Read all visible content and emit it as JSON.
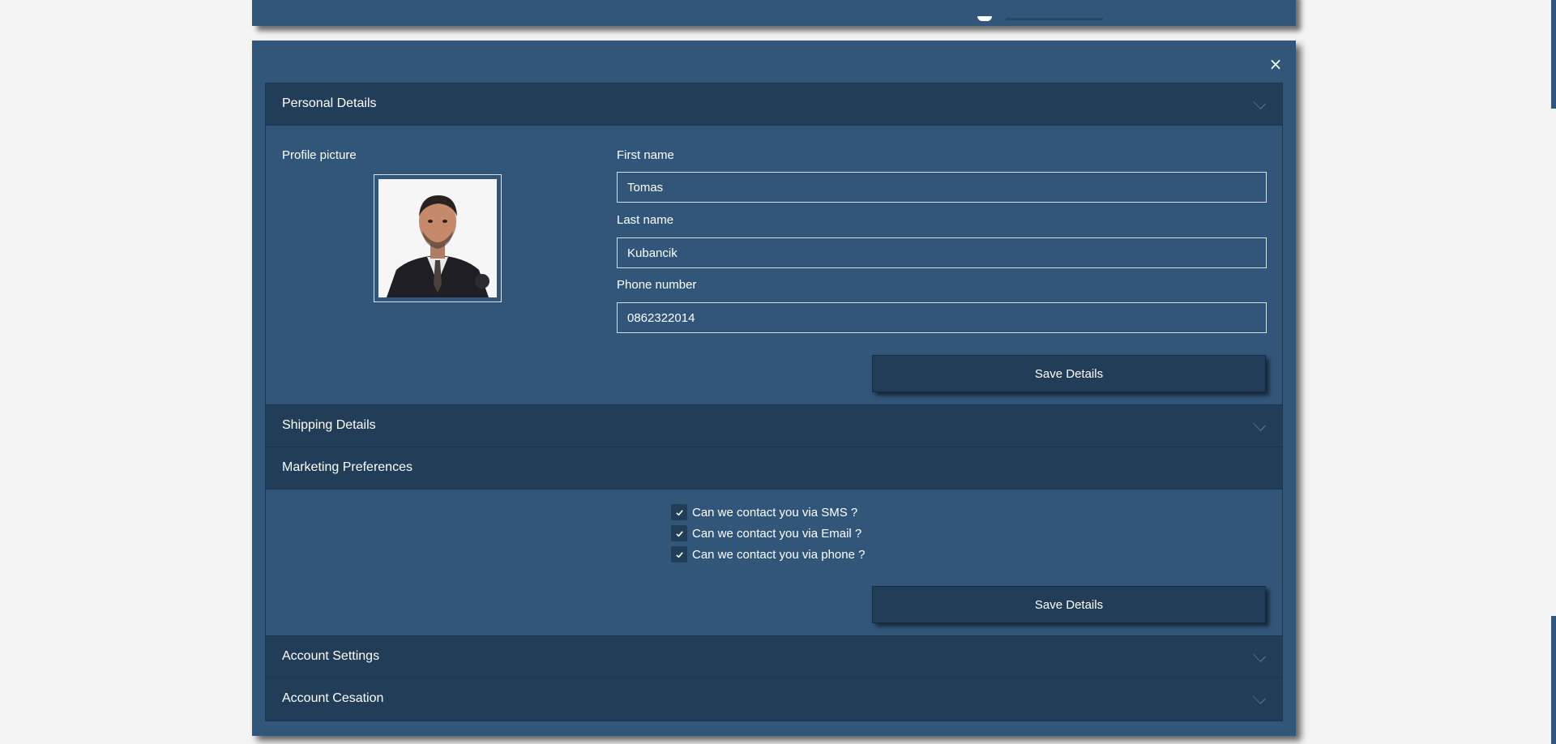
{
  "modal": {
    "close_label": "×",
    "sections": {
      "personal": {
        "title": "Personal Details",
        "profile_picture_label": "Profile picture",
        "first_name_label": "First name",
        "first_name_value": "Tomas",
        "last_name_label": "Last name",
        "last_name_value": "Kubancik",
        "phone_label": "Phone number",
        "phone_value": "0862322014",
        "save_label": "Save Details"
      },
      "shipping": {
        "title": "Shipping Details"
      },
      "marketing": {
        "title": "Marketing Preferences",
        "options": [
          {
            "label": "Can we contact you via SMS ?",
            "checked": true
          },
          {
            "label": "Can we contact you via Email ?",
            "checked": true
          },
          {
            "label": "Can we contact you via phone ?",
            "checked": true
          }
        ],
        "save_label": "Save Details"
      },
      "account_settings": {
        "title": "Account Settings"
      },
      "account_cessation": {
        "title": "Account Cesation"
      }
    }
  },
  "icons": {
    "close": "close-icon",
    "chevron": "chevron-down-icon",
    "check": "check-icon"
  },
  "colors": {
    "panel": "#32567a",
    "header": "#223d58",
    "page_bg": "#f4f4f4",
    "text": "#ffffff"
  }
}
